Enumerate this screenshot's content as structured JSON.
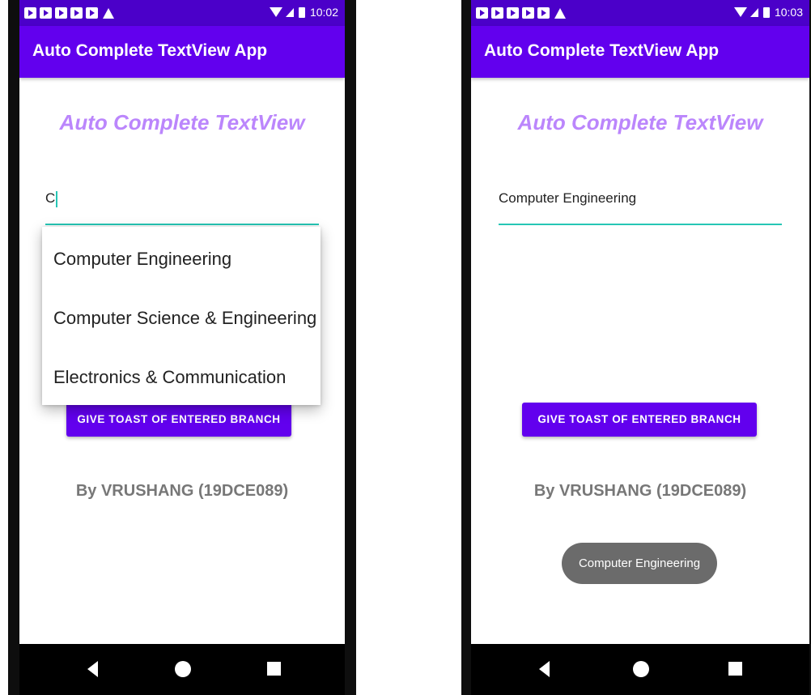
{
  "left": {
    "status_time": "10:02",
    "app_title": "Auto Complete TextView App",
    "heading": "Auto Complete TextView",
    "input_value": "C",
    "suggestions": [
      "Computer Engineering",
      "Computer Science & Engineering",
      "Electronics & Communication"
    ],
    "button_label": "GIVE TOAST OF ENTERED BRANCH",
    "byline": "By VRUSHANG (19DCE089)"
  },
  "right": {
    "status_time": "10:03",
    "app_title": "Auto Complete TextView App",
    "heading": "Auto Complete TextView",
    "input_value": "Computer Engineering",
    "button_label": "GIVE TOAST OF ENTERED BRANCH",
    "byline": "By VRUSHANG (19DCE089)",
    "toast": "Computer Engineering"
  },
  "colors": {
    "status_bar": "#4b00c9",
    "app_bar": "#6200ee",
    "heading": "#bb86fc",
    "accent_underline": "#26c6b5",
    "byline": "#777777",
    "toast_bg": "#6b6b6b"
  },
  "icons": [
    "notification-icon",
    "warning-icon",
    "wifi-icon",
    "signal-icon",
    "battery-icon",
    "back-icon",
    "home-icon",
    "recents-icon"
  ]
}
